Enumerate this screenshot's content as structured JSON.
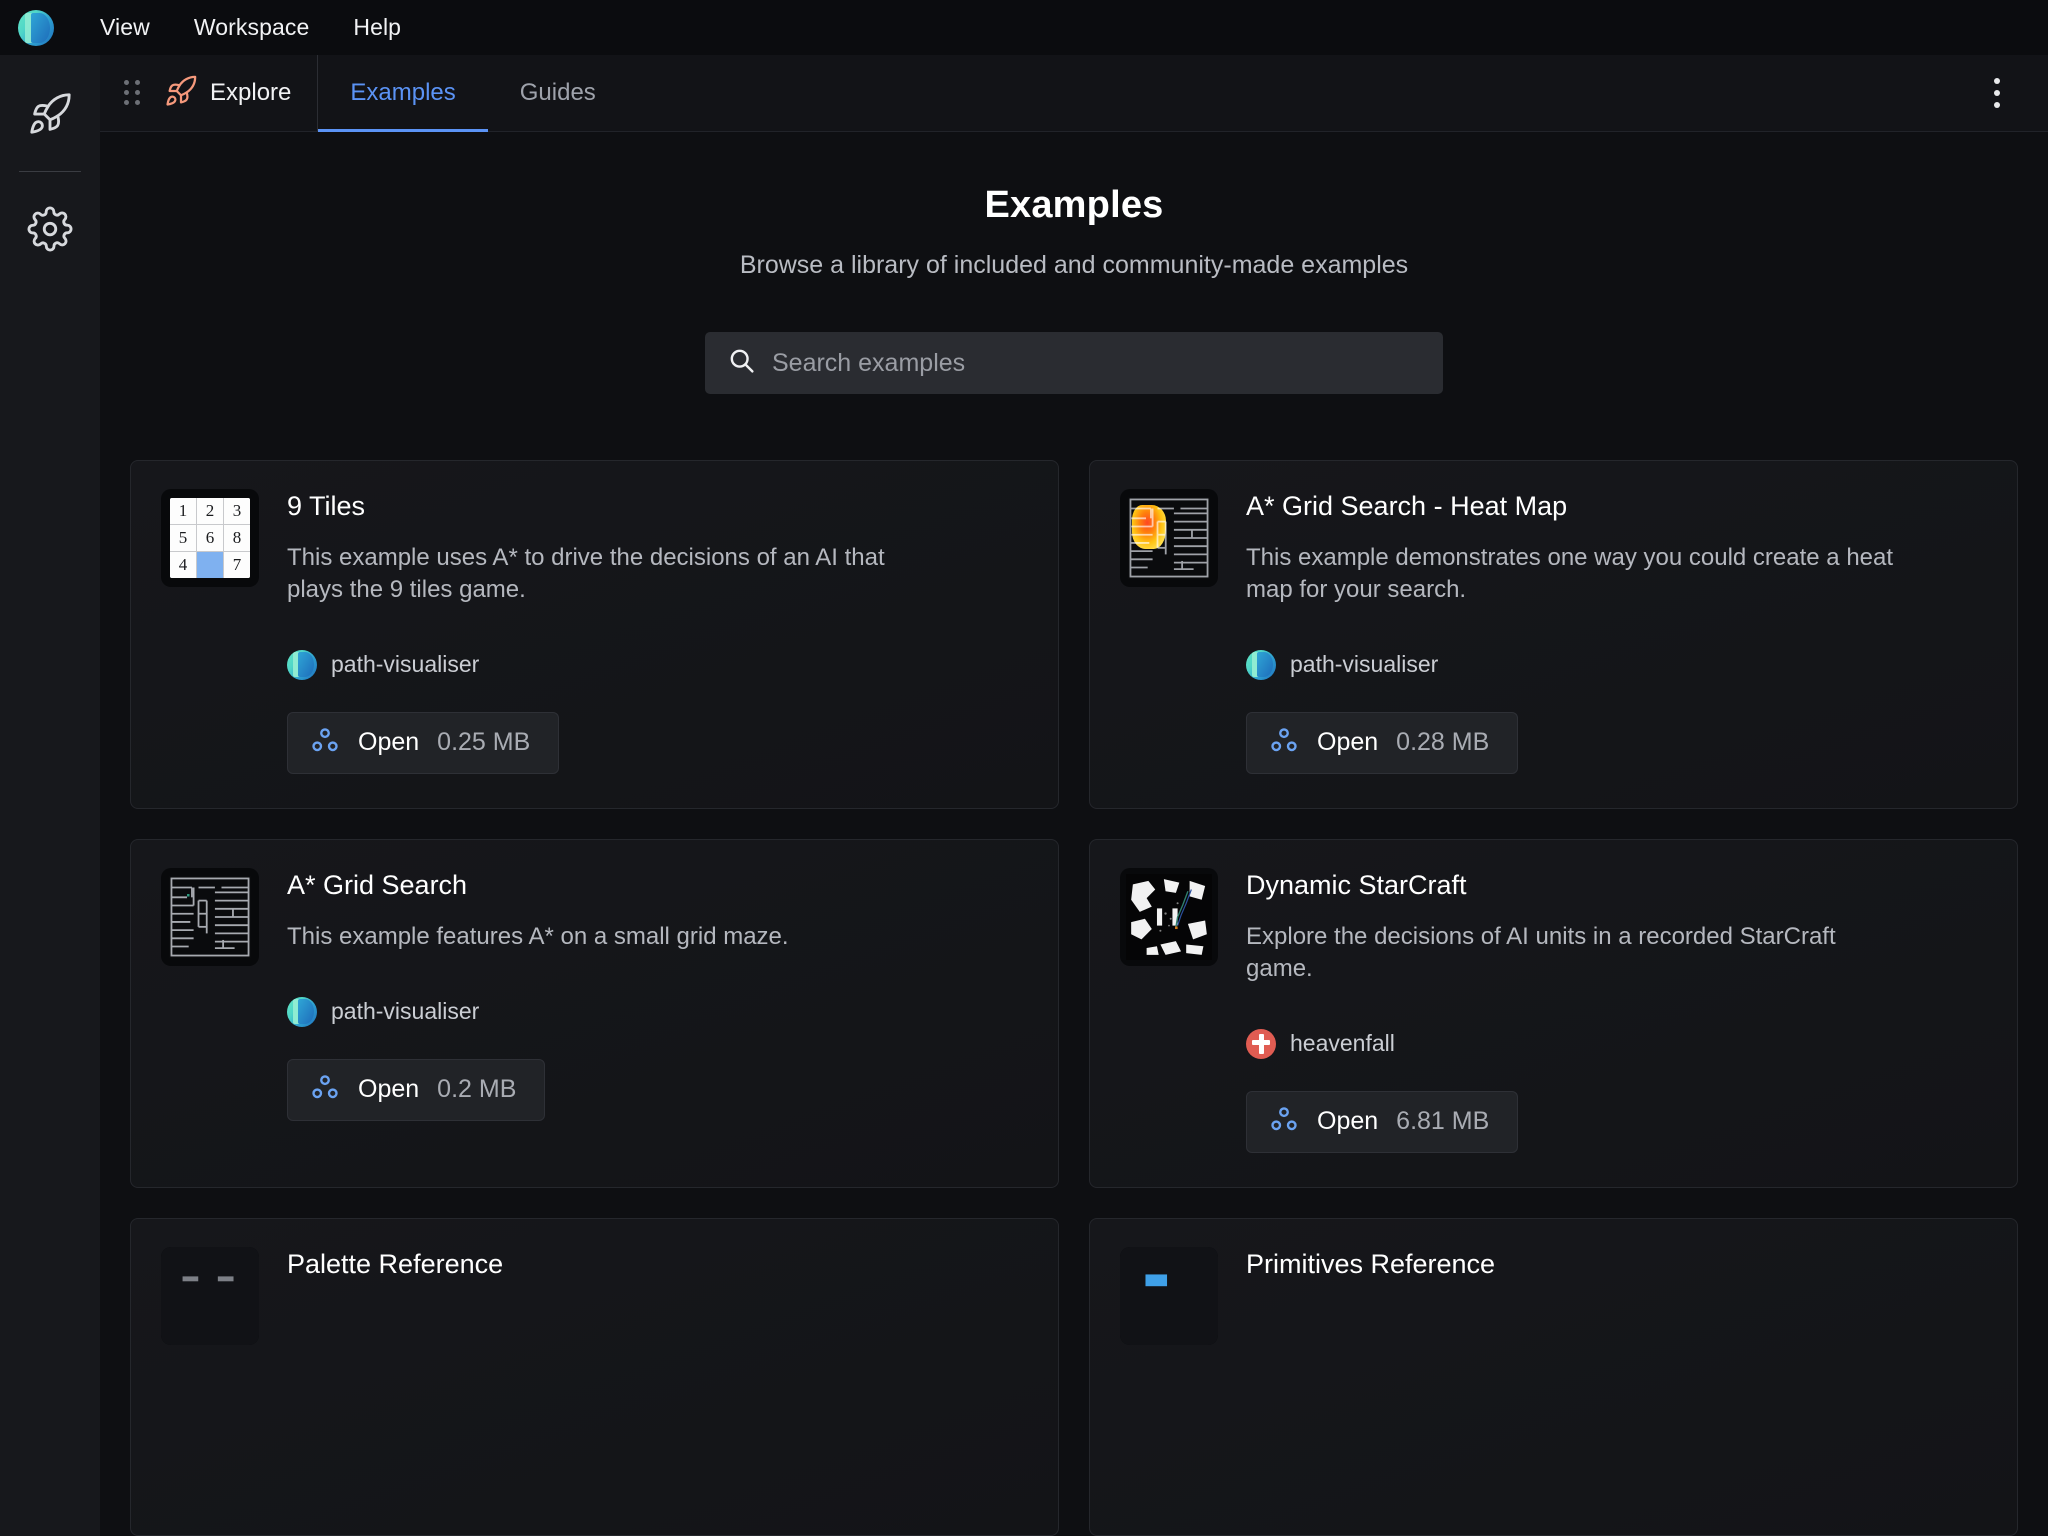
{
  "app": {
    "logo_icon": "app-logo-gradient-sphere",
    "menu": [
      {
        "label": "View"
      },
      {
        "label": "Workspace"
      },
      {
        "label": "Help"
      }
    ]
  },
  "rail": {
    "items": [
      {
        "icon": "rocket-icon",
        "name": "explore"
      },
      {
        "icon": "gear-icon",
        "name": "settings"
      }
    ]
  },
  "tabstrip": {
    "drag_handle_icon": "drag-dots-icon",
    "explore": {
      "icon": "rocket-icon",
      "label": "Explore"
    },
    "tabs": [
      {
        "label": "Examples",
        "active": true
      },
      {
        "label": "Guides",
        "active": false
      }
    ],
    "overflow_icon": "kebab-menu-icon",
    "accent_color": "#5b93f5"
  },
  "main": {
    "title": "Examples",
    "subtitle": "Browse a library of included and community-made examples",
    "search": {
      "icon": "search-icon",
      "placeholder": "Search examples",
      "value": ""
    },
    "cards": [
      {
        "title": "9 Tiles",
        "description": "This example uses A* to drive the decisions of an AI that plays the 9 tiles game.",
        "author": "path-visualiser",
        "author_avatar": "app-logo-gradient-sphere",
        "thumbnail": "nine-tiles-grid",
        "tiles": [
          "1",
          "2",
          "3",
          "5",
          "6",
          "8",
          "4",
          "",
          "7"
        ],
        "open_label": "Open",
        "size": "0.25 MB",
        "open_icon": "three-circles-icon"
      },
      {
        "title": "A* Grid Search - Heat Map",
        "description": "This example demonstrates one way you could create a heat map for your search.",
        "author": "path-visualiser",
        "author_avatar": "app-logo-gradient-sphere",
        "thumbnail": "grid-maze-heatmap",
        "open_label": "Open",
        "size": "0.28 MB",
        "open_icon": "three-circles-icon"
      },
      {
        "title": "A* Grid Search",
        "description": "This example features A* on a small grid maze.",
        "author": "path-visualiser",
        "author_avatar": "app-logo-gradient-sphere",
        "thumbnail": "grid-maze",
        "open_label": "Open",
        "size": "0.2 MB",
        "open_icon": "three-circles-icon"
      },
      {
        "title": "Dynamic StarCraft",
        "description": "Explore the decisions of AI units in a recorded StarCraft game.",
        "author": "heavenfall",
        "author_avatar": "red-cross-avatar",
        "thumbnail": "starcraft-map",
        "open_label": "Open",
        "size": "6.81 MB",
        "open_icon": "three-circles-icon"
      },
      {
        "title": "Palette Reference",
        "description": "",
        "author": "",
        "author_avatar": "",
        "thumbnail": "palette-reference",
        "open_label": "",
        "size": "",
        "open_icon": ""
      },
      {
        "title": "Primitives Reference",
        "description": "",
        "author": "",
        "author_avatar": "",
        "thumbnail": "primitives-reference",
        "open_label": "",
        "size": "",
        "open_icon": ""
      }
    ]
  }
}
